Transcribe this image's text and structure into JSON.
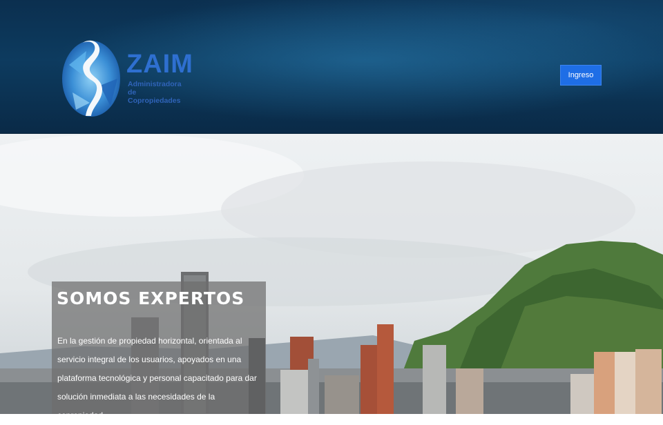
{
  "header": {
    "logo": {
      "name": "ZAIM",
      "tagline_line1": "Administradora de",
      "tagline_line2": "Copropiedades"
    },
    "login_button": "Ingreso"
  },
  "hero": {
    "title": "SOMOS EXPERTOS",
    "description": "En la gestión de propiedad horizontal, orientada al servicio integral de los usuarios, apoyados en una plataforma tecnológica y personal capacitado para dar solución inmediata a las necesidades de la copropiedad."
  },
  "colors": {
    "header_bg": "#0b2f4f",
    "brand_blue": "#2e6fd0",
    "button_bg": "#1e6ee6"
  },
  "icons": {
    "logo": "zaim-logo-icon"
  }
}
